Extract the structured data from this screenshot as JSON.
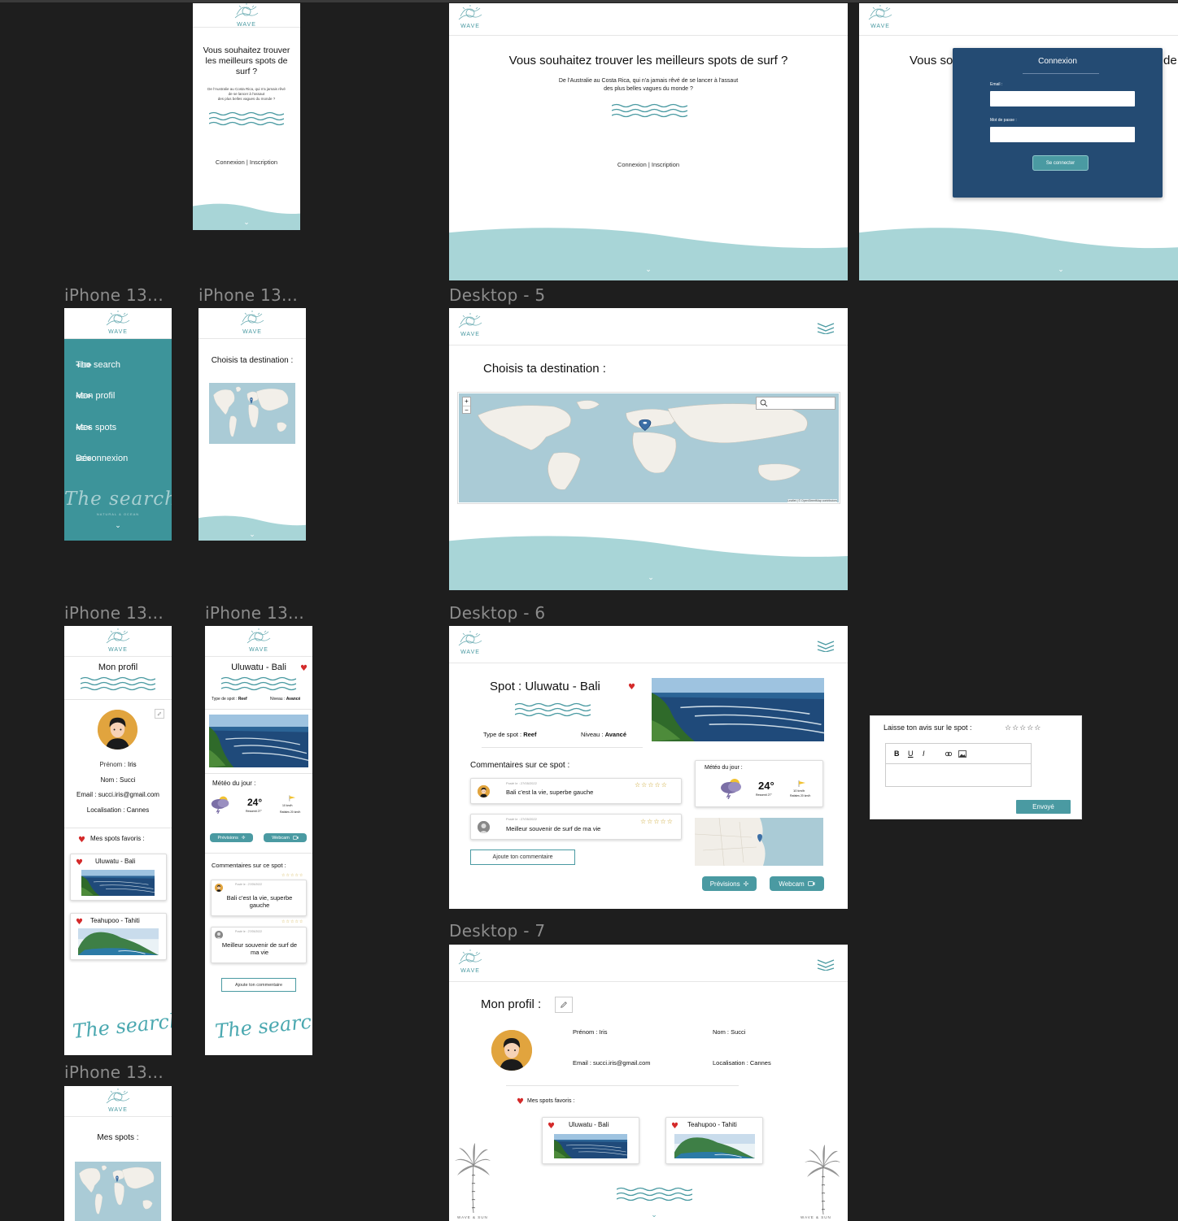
{
  "colors": {
    "canvas": "#1e1e1e",
    "teal": "#4a9aa2",
    "wave": "#a8d5d7",
    "menu": "#3d949a",
    "modal": "#244b73",
    "heart": "#d42a2a",
    "avatar": "#e1a43e"
  },
  "frame_labels": {
    "iphone_menu": "iPhone 13...",
    "iphone_destination": "iPhone 13...",
    "desktop5": "Desktop - 5",
    "iphone_profile": "iPhone 13...",
    "iphone_spot": "iPhone 13...",
    "desktop6": "Desktop - 6",
    "desktop7": "Desktop - 7",
    "iphone_myspots": "iPhone 13..."
  },
  "logo": {
    "text": "WAVE",
    "icon": "wave-sun-logo-icon"
  },
  "home": {
    "title": "Vous souhaitez trouver les meilleurs spots de surf ?",
    "title_mobile_l1": "Vous souhaitez trouver",
    "title_mobile_l2": "les meilleurs spots de",
    "title_mobile_l3": "surf ?",
    "subtitle_l1": "De l'Australie au Costa Rica, qui n'a jamais rêvé de se lancer à l'assaut",
    "subtitle_l2": "des plus belles vagues du monde ?",
    "sub_mobile_l1": "De l'Australie au Costa Rica, qui n'a jamais rêvé",
    "sub_mobile_l2": "de se lancer à l'assaut",
    "sub_mobile_l3": "des plus belles vagues du monde ?",
    "auth_links": "Connexion | Inscription",
    "partial_title": "Vous so",
    "partial_title_end": "de"
  },
  "login": {
    "title": "Connexion",
    "email_label": "Email :",
    "password_label": "Mot de passe :",
    "email_value": "",
    "password_value": "",
    "submit": "Se connecter"
  },
  "menu": {
    "items": [
      {
        "label": "The search",
        "icon": "surfboard-icon"
      },
      {
        "label": "Mon profil",
        "icon": "surfboard-icon"
      },
      {
        "label": "Mes spots",
        "icon": "surfboard-icon"
      },
      {
        "label": "Déconnexion",
        "icon": "surfboard-icon"
      }
    ],
    "signature": "The search",
    "signature_sub": "NATURAL & OCEAN"
  },
  "destination": {
    "title": "Choisis ta destination :",
    "zoom_in": "+",
    "zoom_out": "−",
    "search_placeholder": "",
    "attribution": "Leaflet | © OpenStreetMap contributors"
  },
  "spot": {
    "prefix": "Spot  : ",
    "name": "Uluwatu - Bali",
    "type_label": "Type de spot : ",
    "type_value": "Reef",
    "level_label": "Niveau : ",
    "level_value": "Avancé",
    "comments_title": "Commentaires sur ce spot :",
    "comments": [
      {
        "date": "Posté le : 27/05/2022",
        "text": "Bali c'est la vie, superbe gauche",
        "text_mobile_l1": "Bali c'est la vie, superbe",
        "text_mobile_l2": "gauche",
        "stars": "☆☆☆☆☆",
        "stars_alt": "☆☆☆☆☆"
      },
      {
        "date": "Posté le : 27/05/2022",
        "text": "Meilleur souvenir de surf de ma vie",
        "text_mobile_l1": "Meilleur souvenir de surf de",
        "text_mobile_l2": "ma vie",
        "stars": "☆☆☆☆☆",
        "stars_alt": "☆☆☆☆☆"
      }
    ],
    "add_comment": "Ajoute ton commentaire",
    "weather_title": "Météo du jour :",
    "temp": "24°",
    "feels": "Ressenti 27°",
    "wind_value": "10 km/h",
    "wind_label": "Rafales 20 km/h",
    "forecast_btn": "Prévisions",
    "webcam_btn": "Webcam"
  },
  "review": {
    "title": "Laisse ton avis sur le spot :",
    "stars": "☆☆☆☆☆",
    "toolbar": {
      "bold": "B",
      "underline": "U",
      "italic": "I"
    },
    "text_value": "",
    "submit": "Envoyé"
  },
  "profile": {
    "title": "Mon profil :",
    "title_mobile": "Mon profil",
    "first_label": "Prénom : ",
    "first_value": "Iris",
    "last_label": "Nom : ",
    "last_value": "Succi",
    "email_label": "Email : ",
    "email_value": "succi.iris@gmail.com",
    "loc_label": "Localisation : ",
    "loc_value": "Cannes",
    "favs_title": "Mes spots favoris :",
    "favs": [
      {
        "name": "Uluwatu - Bali"
      },
      {
        "name": "Teahupoo - Tahiti"
      }
    ],
    "signature": "The search",
    "brand_left": "WAVE & SUN",
    "brand_right": "WAVE & SUN"
  },
  "myspots": {
    "title": "Mes spots :"
  }
}
